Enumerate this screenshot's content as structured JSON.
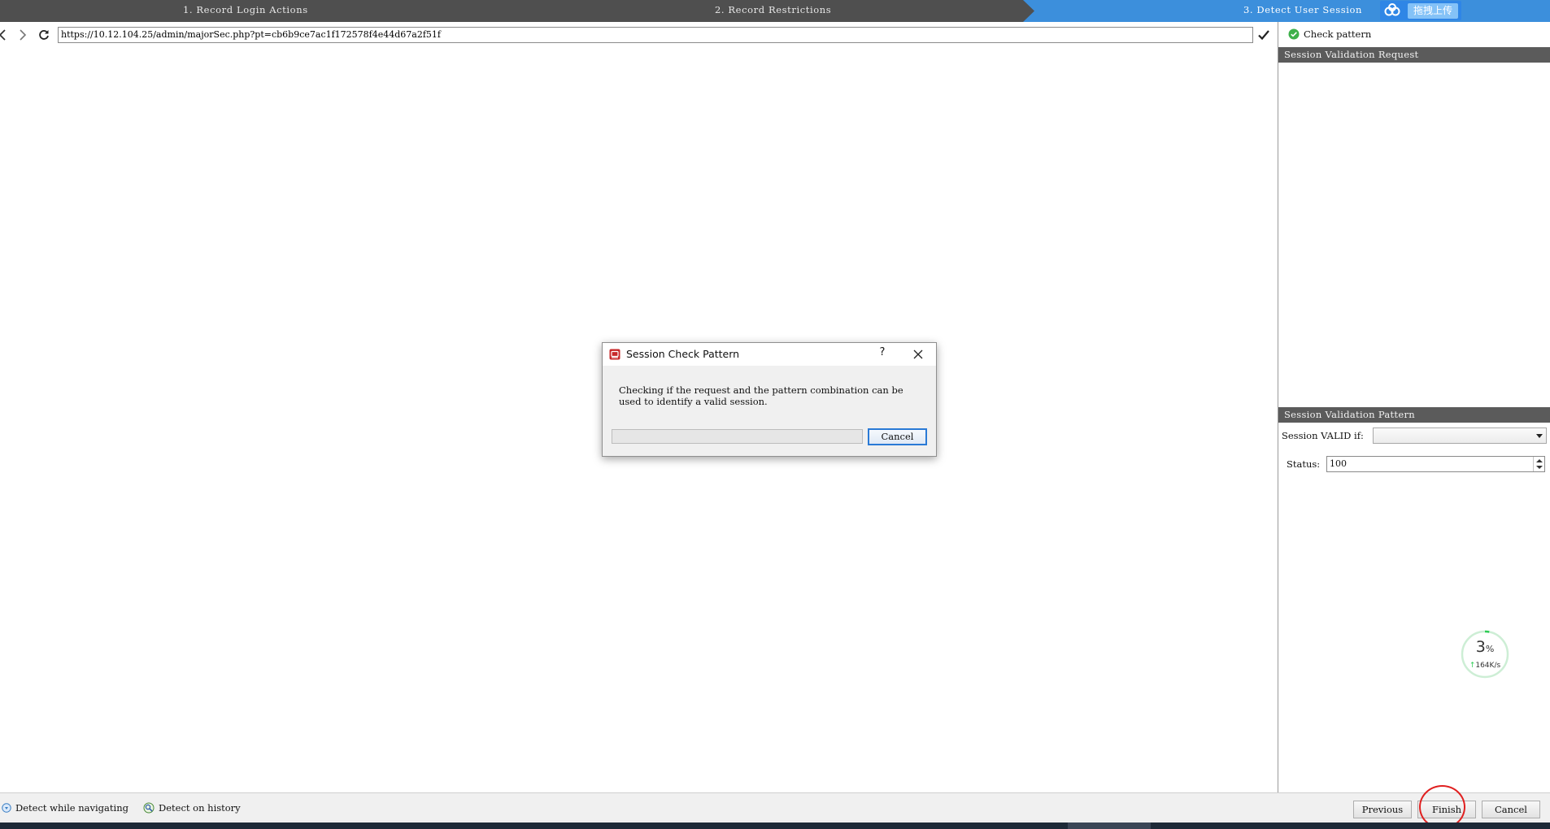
{
  "wizard": {
    "steps": [
      {
        "label": "1. Record Login Actions",
        "active": false
      },
      {
        "label": "2. Record Restrictions",
        "active": false
      },
      {
        "label": "3. Detect User Session",
        "active": true
      }
    ],
    "active_color": "#3c8fdc",
    "overlay_upload_label": "拖拽上传"
  },
  "browser": {
    "url": "https://10.12.104.25/admin/majorSec.php?pt=cb6b9ce7ac1f172578f4e44d67a2f51f",
    "icons": [
      "back-icon",
      "forward-icon",
      "refresh-icon",
      "checkmark-icon"
    ]
  },
  "right_panel": {
    "check_pattern_label": "Check pattern",
    "request_section_title": "Session Validation Request",
    "pattern_section_title": "Session Validation Pattern",
    "valid_if_label": "Session VALID if:",
    "valid_if_value": "",
    "status_label": "Status:",
    "status_value": "100"
  },
  "progress_widget": {
    "percent": "3",
    "percent_unit": "%",
    "speed": "164K/s",
    "percent_value": 3,
    "ring_color": "#2ecc55"
  },
  "bottom_bar": {
    "detect_navigating_label": "Detect while navigating",
    "detect_history_label": "Detect on history",
    "previous_label": "Previous",
    "finish_label": "Finish",
    "cancel_label": "Cancel",
    "highlight_color": "#e02020"
  },
  "dialog": {
    "title": "Session Check Pattern",
    "help_label": "?",
    "message_line1": "Checking if the request and the pattern combination can be",
    "message_line2": "used to identify a valid session.",
    "progress_value": 0,
    "cancel_label": "Cancel"
  }
}
